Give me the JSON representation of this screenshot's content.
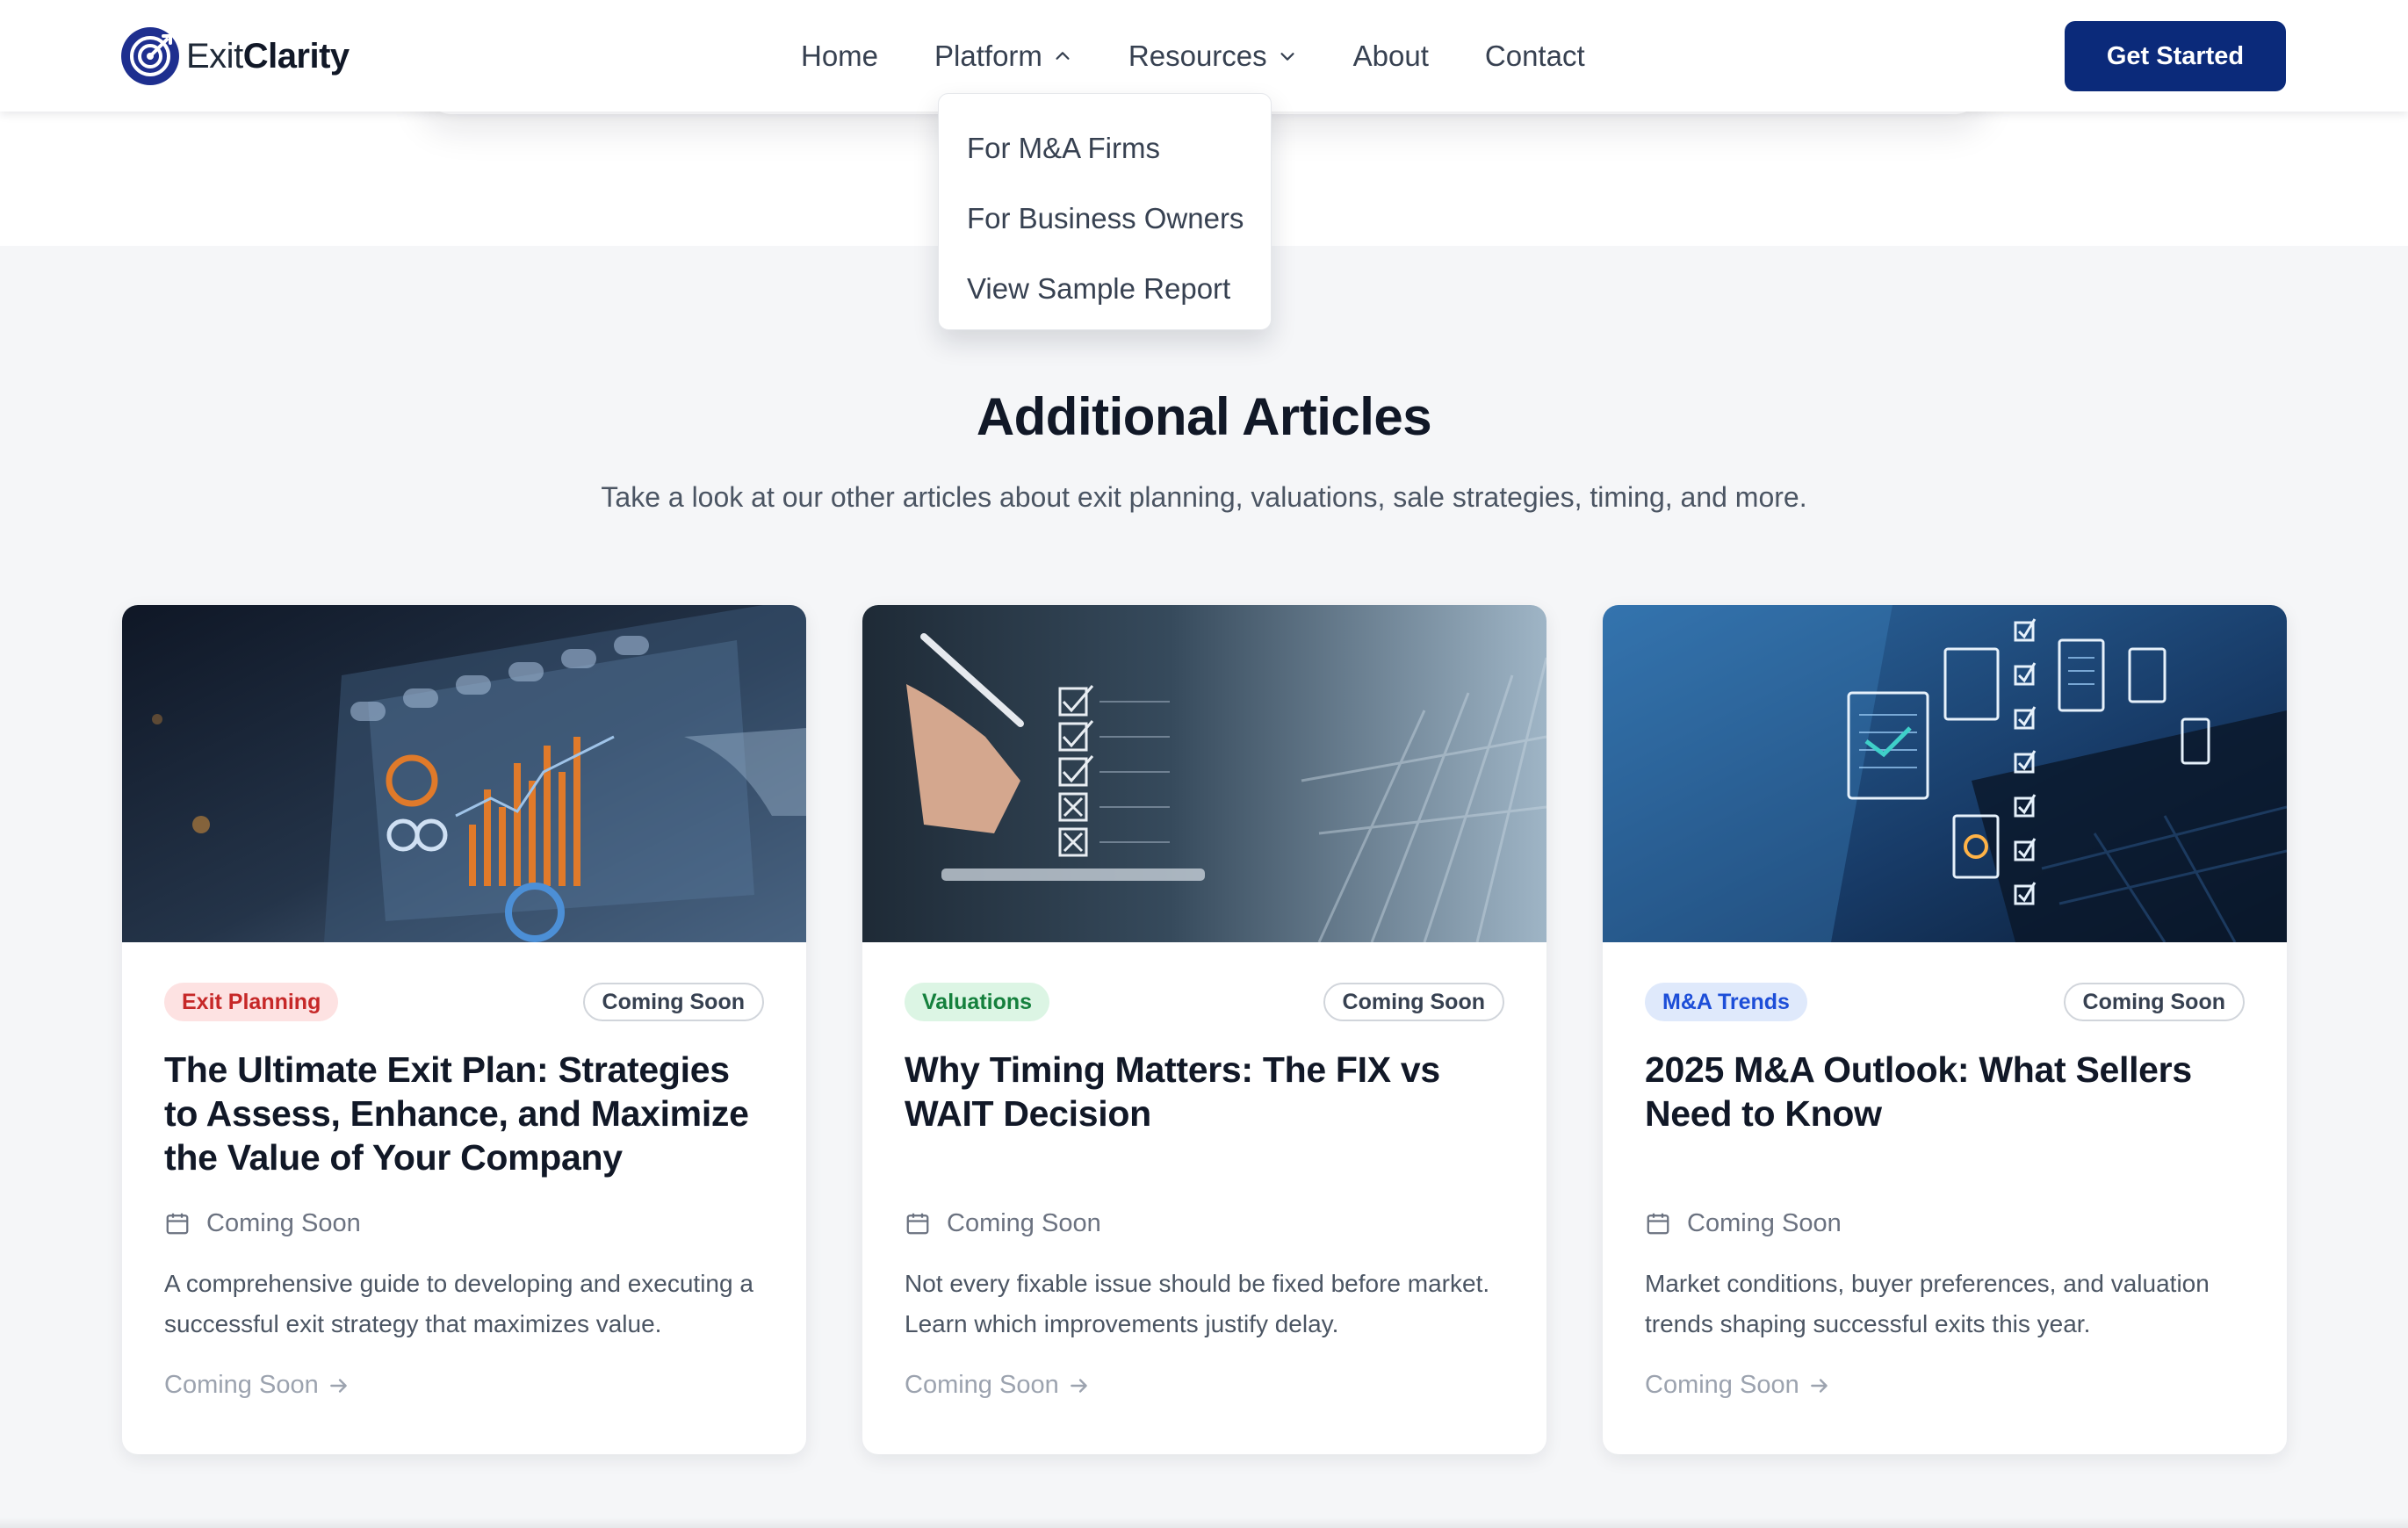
{
  "header": {
    "logo_prefix": "Exit",
    "logo_suffix": "Clarity",
    "nav": [
      {
        "label": "Home"
      },
      {
        "label": "Platform",
        "icon": "chevron-up-icon"
      },
      {
        "label": "Resources",
        "icon": "chevron-down-icon"
      },
      {
        "label": "About"
      },
      {
        "label": "Contact"
      }
    ],
    "cta_label": "Get Started"
  },
  "dropdown": {
    "items": [
      "For M&A Firms",
      "For Business Owners",
      "View Sample Report"
    ]
  },
  "section": {
    "title": "Additional Articles",
    "subtitle": "Take a look at our other articles about exit planning, valuations, sale strategies, timing, and more."
  },
  "cards": [
    {
      "tag": "Exit Planning",
      "tag_color": "#c62828",
      "status": "Coming Soon",
      "title": "The Ultimate Exit Plan: Strategies to Assess, Enhance, and Maximize the Value of Your Company",
      "date": "Coming Soon",
      "description": "A comprehensive guide to developing and executing a successful exit strategy that maximizes value.",
      "link": "Coming Soon"
    },
    {
      "tag": "Valuations",
      "tag_color": "#15803d",
      "status": "Coming Soon",
      "title": "Why Timing Matters: The FIX vs WAIT Decision",
      "date": "Coming Soon",
      "description": "Not every fixable issue should be fixed before market. Learn which improvements justify delay.",
      "link": "Coming Soon"
    },
    {
      "tag": "M&A Trends",
      "tag_color": "#1d4ed8",
      "status": "Coming Soon",
      "title": "2025 M&A Outlook: What Sellers Need to Know",
      "date": "Coming Soon",
      "description": "Market conditions, buyer preferences, and valuation trends shaping successful exits this year.",
      "link": "Coming Soon"
    }
  ],
  "colors": {
    "brand": "#0b2a7a",
    "text": "#111827",
    "muted": "#6b7280"
  }
}
